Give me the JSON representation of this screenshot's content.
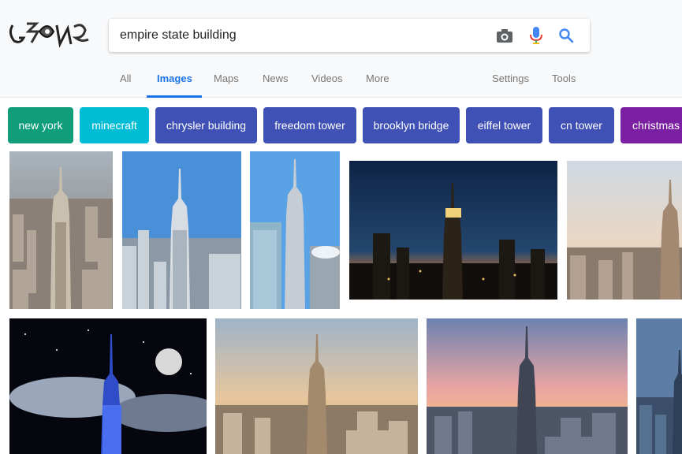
{
  "search": {
    "query": "empire state building"
  },
  "icons": {
    "logo": "doodle-logo",
    "camera": "camera-icon",
    "mic": "mic-icon",
    "search": "search-icon"
  },
  "tabs": [
    {
      "label": "All"
    },
    {
      "label": "Images",
      "active": true
    },
    {
      "label": "Maps"
    },
    {
      "label": "News"
    },
    {
      "label": "Videos"
    },
    {
      "label": "More"
    }
  ],
  "tools": {
    "settings": "Settings",
    "tools": "Tools"
  },
  "chips": [
    {
      "label": "new york",
      "color": "#0f9d7a"
    },
    {
      "label": "minecraft",
      "color": "#00bcd4"
    },
    {
      "label": "chrysler building",
      "color": "#3f51b5"
    },
    {
      "label": "freedom tower",
      "color": "#3f51b5"
    },
    {
      "label": "brooklyn bridge",
      "color": "#3f51b5"
    },
    {
      "label": "eiffel tower",
      "color": "#3f51b5"
    },
    {
      "label": "cn tower",
      "color": "#3f51b5"
    },
    {
      "label": "christmas",
      "color": "#7b1fa2"
    }
  ],
  "colors": {
    "accent": "#1a73e8"
  }
}
